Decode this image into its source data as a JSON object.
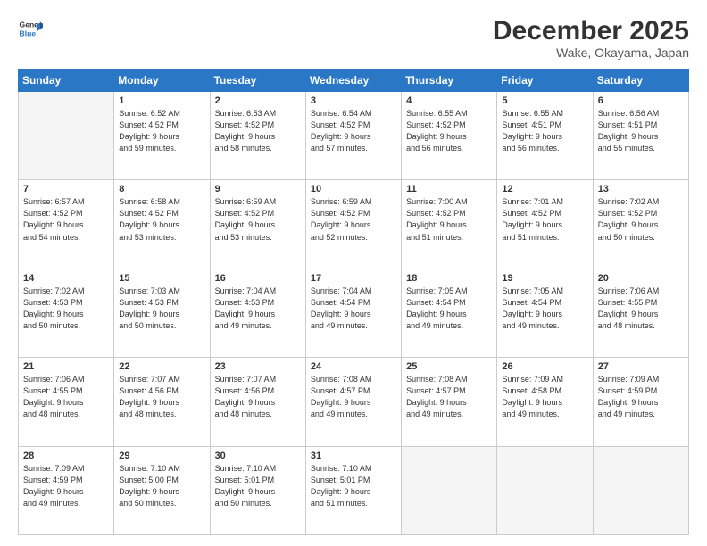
{
  "logo": {
    "line1": "General",
    "line2": "Blue"
  },
  "title": "December 2025",
  "location": "Wake, Okayama, Japan",
  "days_of_week": [
    "Sunday",
    "Monday",
    "Tuesday",
    "Wednesday",
    "Thursday",
    "Friday",
    "Saturday"
  ],
  "weeks": [
    [
      {
        "day": "",
        "info": ""
      },
      {
        "day": "1",
        "info": "Sunrise: 6:52 AM\nSunset: 4:52 PM\nDaylight: 9 hours\nand 59 minutes."
      },
      {
        "day": "2",
        "info": "Sunrise: 6:53 AM\nSunset: 4:52 PM\nDaylight: 9 hours\nand 58 minutes."
      },
      {
        "day": "3",
        "info": "Sunrise: 6:54 AM\nSunset: 4:52 PM\nDaylight: 9 hours\nand 57 minutes."
      },
      {
        "day": "4",
        "info": "Sunrise: 6:55 AM\nSunset: 4:52 PM\nDaylight: 9 hours\nand 56 minutes."
      },
      {
        "day": "5",
        "info": "Sunrise: 6:55 AM\nSunset: 4:51 PM\nDaylight: 9 hours\nand 56 minutes."
      },
      {
        "day": "6",
        "info": "Sunrise: 6:56 AM\nSunset: 4:51 PM\nDaylight: 9 hours\nand 55 minutes."
      }
    ],
    [
      {
        "day": "7",
        "info": "Sunrise: 6:57 AM\nSunset: 4:52 PM\nDaylight: 9 hours\nand 54 minutes."
      },
      {
        "day": "8",
        "info": "Sunrise: 6:58 AM\nSunset: 4:52 PM\nDaylight: 9 hours\nand 53 minutes."
      },
      {
        "day": "9",
        "info": "Sunrise: 6:59 AM\nSunset: 4:52 PM\nDaylight: 9 hours\nand 53 minutes."
      },
      {
        "day": "10",
        "info": "Sunrise: 6:59 AM\nSunset: 4:52 PM\nDaylight: 9 hours\nand 52 minutes."
      },
      {
        "day": "11",
        "info": "Sunrise: 7:00 AM\nSunset: 4:52 PM\nDaylight: 9 hours\nand 51 minutes."
      },
      {
        "day": "12",
        "info": "Sunrise: 7:01 AM\nSunset: 4:52 PM\nDaylight: 9 hours\nand 51 minutes."
      },
      {
        "day": "13",
        "info": "Sunrise: 7:02 AM\nSunset: 4:52 PM\nDaylight: 9 hours\nand 50 minutes."
      }
    ],
    [
      {
        "day": "14",
        "info": "Sunrise: 7:02 AM\nSunset: 4:53 PM\nDaylight: 9 hours\nand 50 minutes."
      },
      {
        "day": "15",
        "info": "Sunrise: 7:03 AM\nSunset: 4:53 PM\nDaylight: 9 hours\nand 50 minutes."
      },
      {
        "day": "16",
        "info": "Sunrise: 7:04 AM\nSunset: 4:53 PM\nDaylight: 9 hours\nand 49 minutes."
      },
      {
        "day": "17",
        "info": "Sunrise: 7:04 AM\nSunset: 4:54 PM\nDaylight: 9 hours\nand 49 minutes."
      },
      {
        "day": "18",
        "info": "Sunrise: 7:05 AM\nSunset: 4:54 PM\nDaylight: 9 hours\nand 49 minutes."
      },
      {
        "day": "19",
        "info": "Sunrise: 7:05 AM\nSunset: 4:54 PM\nDaylight: 9 hours\nand 49 minutes."
      },
      {
        "day": "20",
        "info": "Sunrise: 7:06 AM\nSunset: 4:55 PM\nDaylight: 9 hours\nand 48 minutes."
      }
    ],
    [
      {
        "day": "21",
        "info": "Sunrise: 7:06 AM\nSunset: 4:55 PM\nDaylight: 9 hours\nand 48 minutes."
      },
      {
        "day": "22",
        "info": "Sunrise: 7:07 AM\nSunset: 4:56 PM\nDaylight: 9 hours\nand 48 minutes."
      },
      {
        "day": "23",
        "info": "Sunrise: 7:07 AM\nSunset: 4:56 PM\nDaylight: 9 hours\nand 48 minutes."
      },
      {
        "day": "24",
        "info": "Sunrise: 7:08 AM\nSunset: 4:57 PM\nDaylight: 9 hours\nand 49 minutes."
      },
      {
        "day": "25",
        "info": "Sunrise: 7:08 AM\nSunset: 4:57 PM\nDaylight: 9 hours\nand 49 minutes."
      },
      {
        "day": "26",
        "info": "Sunrise: 7:09 AM\nSunset: 4:58 PM\nDaylight: 9 hours\nand 49 minutes."
      },
      {
        "day": "27",
        "info": "Sunrise: 7:09 AM\nSunset: 4:59 PM\nDaylight: 9 hours\nand 49 minutes."
      }
    ],
    [
      {
        "day": "28",
        "info": "Sunrise: 7:09 AM\nSunset: 4:59 PM\nDaylight: 9 hours\nand 49 minutes."
      },
      {
        "day": "29",
        "info": "Sunrise: 7:10 AM\nSunset: 5:00 PM\nDaylight: 9 hours\nand 50 minutes."
      },
      {
        "day": "30",
        "info": "Sunrise: 7:10 AM\nSunset: 5:01 PM\nDaylight: 9 hours\nand 50 minutes."
      },
      {
        "day": "31",
        "info": "Sunrise: 7:10 AM\nSunset: 5:01 PM\nDaylight: 9 hours\nand 51 minutes."
      },
      {
        "day": "",
        "info": ""
      },
      {
        "day": "",
        "info": ""
      },
      {
        "day": "",
        "info": ""
      }
    ]
  ]
}
